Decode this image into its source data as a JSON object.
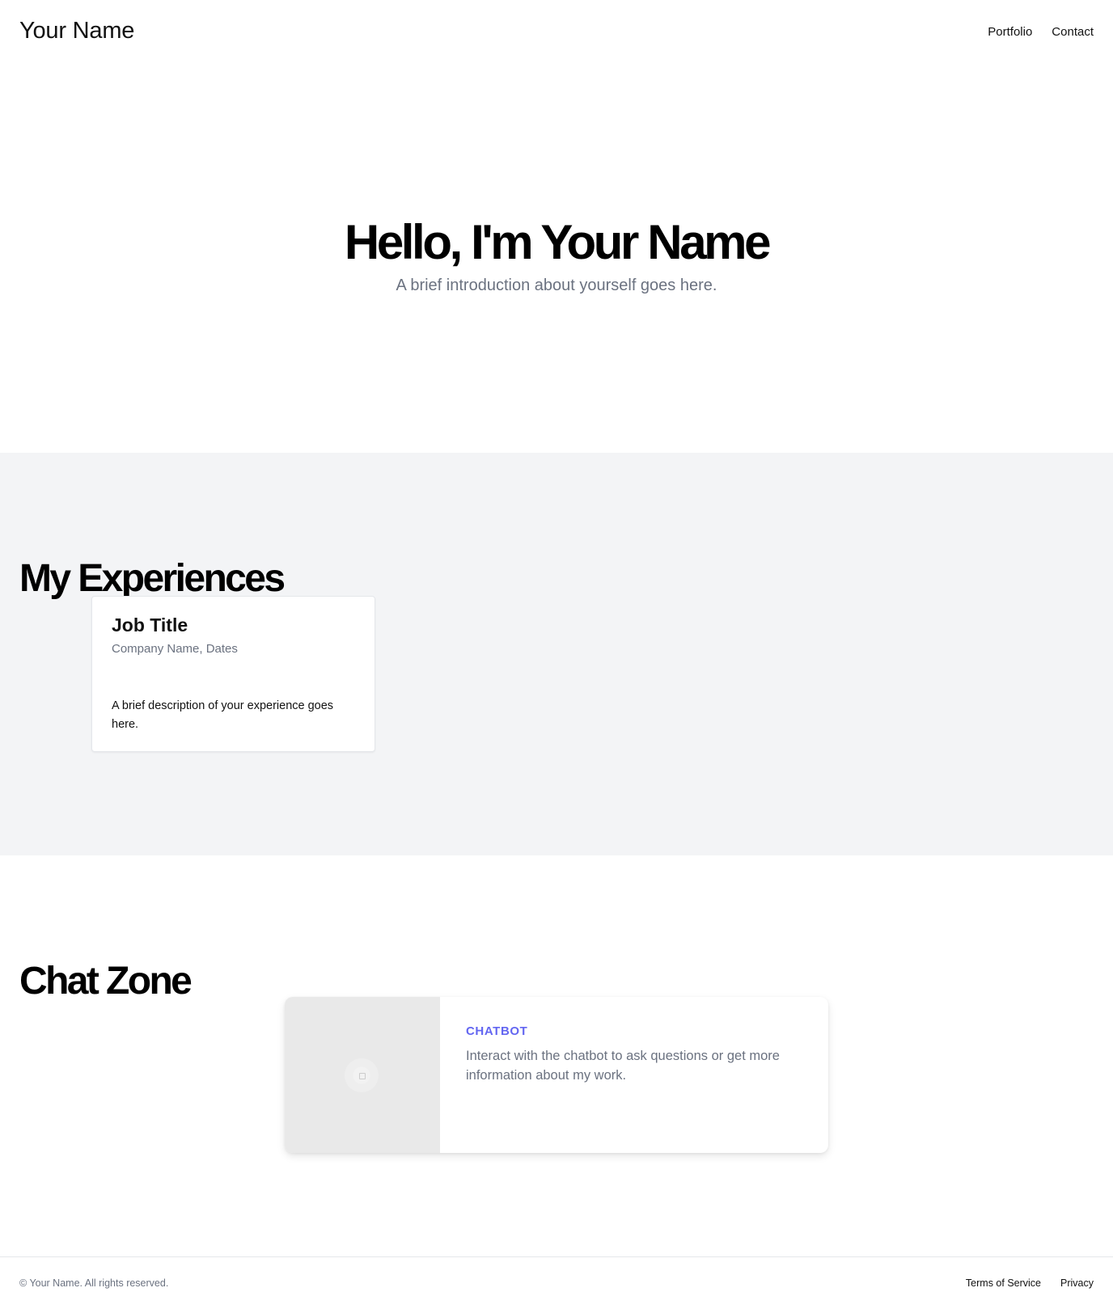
{
  "header": {
    "brand": "Your Name",
    "nav": [
      "Portfolio",
      "Contact"
    ]
  },
  "hero": {
    "title": "Hello, I'm Your Name",
    "subtitle": "A brief introduction about yourself goes here."
  },
  "experiences": {
    "title": "My Experiences",
    "card": {
      "job_title": "Job Title",
      "meta": "Company Name, Dates",
      "description": "A brief description of your experience goes here."
    }
  },
  "chat": {
    "title": "Chat Zone",
    "card": {
      "label": "CHATBOT",
      "description": "Interact with the chatbot to ask questions or get more information about my work."
    },
    "colors": {
      "label": "#6366f1"
    }
  },
  "footer": {
    "copyright": "© Your Name. All rights reserved.",
    "links": [
      "Terms of Service",
      "Privacy"
    ]
  }
}
